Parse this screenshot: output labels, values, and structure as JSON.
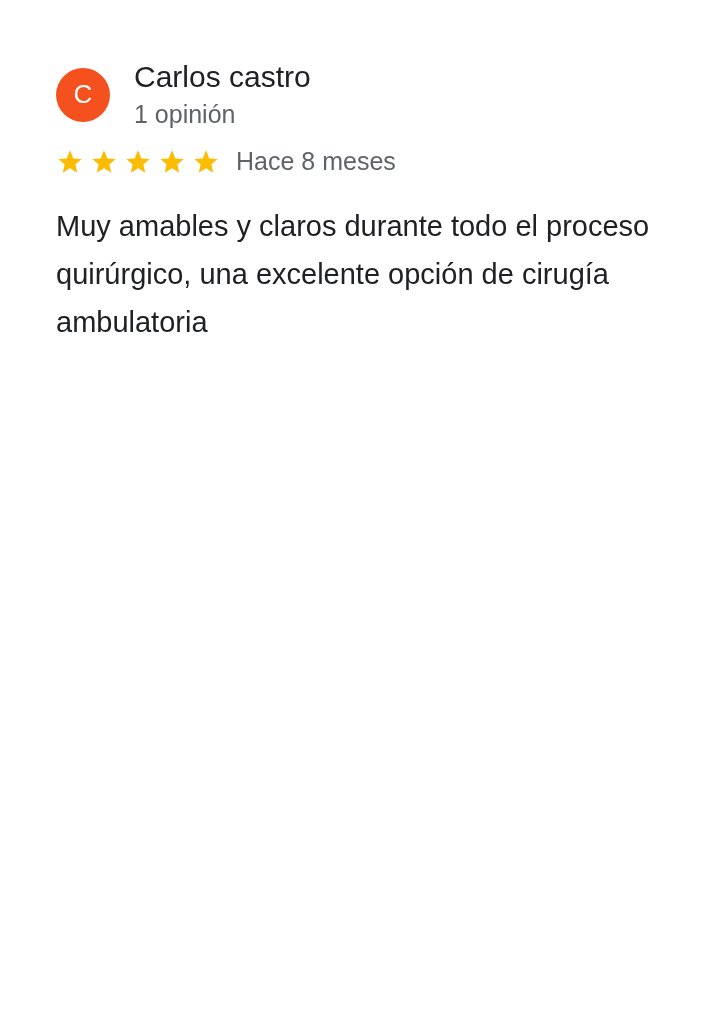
{
  "review": {
    "avatar_letter": "C",
    "author": "Carlos castro",
    "author_meta": "1 opinión",
    "stars": 5,
    "time": "Hace 8 meses",
    "text": "Muy amables y claros durante todo el proceso quirúrgico, una excelente opción de cirugía ambulatoria"
  }
}
